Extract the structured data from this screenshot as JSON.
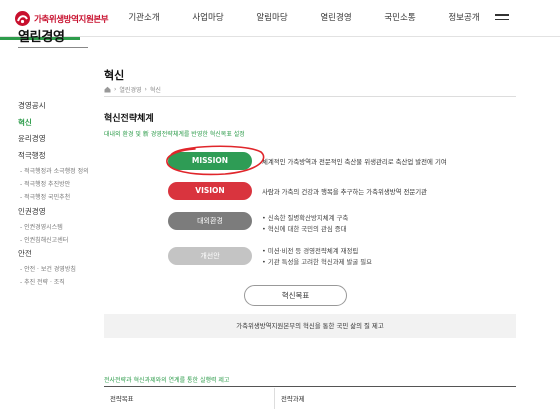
{
  "header": {
    "logo_text": "가축위생방역지원본부",
    "nav": [
      "기관소개",
      "사업마당",
      "알림마당",
      "열린경영",
      "국민소통",
      "정보공개"
    ],
    "menu_icon": "hamburger-menu-icon"
  },
  "sidebar": {
    "title": "열린경영",
    "items": [
      {
        "label": "경영공시"
      },
      {
        "label": "혁신"
      },
      {
        "label": "윤리경영"
      },
      {
        "label": "적극행정"
      },
      {
        "label": "인권경영"
      },
      {
        "label": "안전"
      }
    ],
    "subs": [
      "- 적극행정과 소극행정 정의",
      "- 적극행정 추진방안",
      "- 적극행정 국민추천",
      "- 인권경영시스템",
      "- 인권침해신고센터",
      "- 안전 · 보건 경영방침",
      "- 추진 전략 · 조직"
    ]
  },
  "main": {
    "title": "혁신",
    "breadcrumb": [
      "열린경영",
      "혁신"
    ],
    "section_title": "혁신전략체계",
    "section_sub": "대내외 환경 및 新 경영전략체계를 반영한 혁신목표 설정",
    "mission": {
      "label": "MISSION",
      "text": "체계적인 가축방역과 전문적인 축산물 위생관리로 축산업 발전에 기여"
    },
    "vision": {
      "label": "VISION",
      "text": "사람과 가축의 건강과 행복을 추구하는 가축위생방역 전문기관"
    },
    "environment": {
      "label": "대외환경",
      "lines": [
        "신속한 질병확산방지체계 구축",
        "혁신에 대한 국민의 관심 증대"
      ]
    },
    "improvement": {
      "label": "개선안",
      "lines": [
        "미션·비전 등 경영전략체계 재정립",
        "기관 특성을 고려한 혁신과제 발굴 필요"
      ]
    },
    "goal_button": "혁신목표",
    "goal_text": "가축위생방역지원본부의 혁신을 통한 국민 삶의 질 제고",
    "table_caption": "전사전략과 혁신과제와의 연계를 통한 실행력 제고",
    "table_headers": [
      "전략목표",
      "전략과제"
    ]
  },
  "colors": {
    "accent_green": "#2e9c55",
    "vision_red": "#d9343e",
    "annotation_red": "#e0262b"
  }
}
